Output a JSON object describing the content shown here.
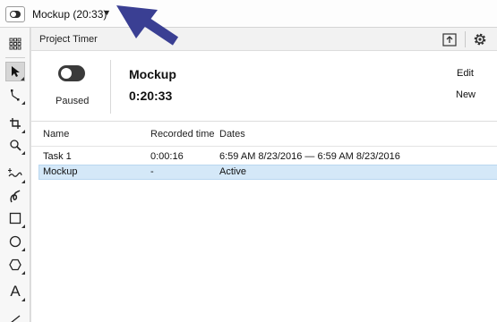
{
  "topbar": {
    "timer_title": "Mockup (20:33)",
    "caret": "▼"
  },
  "toolbox": {
    "tools": [
      {
        "name": "pick-tool-icon",
        "glyph": "↖"
      },
      {
        "name": "shape-tool-icon",
        "glyph": "⤡"
      },
      {
        "name": "crop-tool-icon",
        "glyph": "⌗"
      },
      {
        "name": "zoom-tool-icon",
        "glyph": "⌕"
      },
      {
        "name": "freehand-tool-icon",
        "glyph": "∿"
      },
      {
        "name": "artistic-media-tool-icon",
        "glyph": "ᔕ"
      },
      {
        "name": "rectangle-tool-icon",
        "glyph": "□"
      },
      {
        "name": "ellipse-tool-icon",
        "glyph": "○"
      },
      {
        "name": "polygon-tool-icon",
        "glyph": "⬡"
      },
      {
        "name": "text-tool-icon",
        "glyph": "A"
      }
    ]
  },
  "panel": {
    "title": "Project Timer",
    "status": "Paused",
    "project_name": "Mockup",
    "project_time": "0:20:33",
    "edit_label": "Edit",
    "new_label": "New"
  },
  "table": {
    "columns": [
      "Name",
      "Recorded time",
      "Dates"
    ],
    "rows": [
      {
        "name": "Task 1",
        "recorded": "0:00:16",
        "dates": "6:59 AM 8/23/2016 — 6:59 AM 8/23/2016",
        "selected": false
      },
      {
        "name": "Mockup",
        "recorded": "-",
        "dates": "Active",
        "selected": true
      }
    ]
  },
  "colors": {
    "annotation_arrow": "#3a3f93",
    "selection": "#d4e8f8"
  }
}
